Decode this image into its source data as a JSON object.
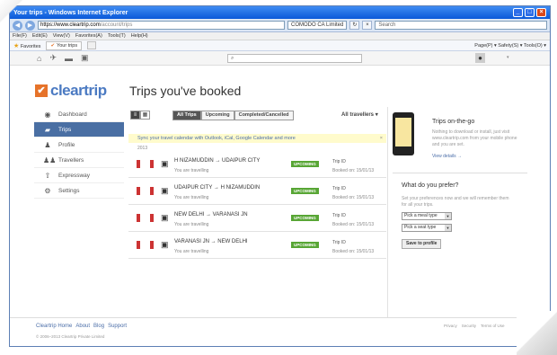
{
  "browser": {
    "title": "Your trips - Windows Internet Explorer",
    "url_host": "https://www.cleartrip.com",
    "url_path": "/account/trips",
    "cert_label": "COMODO CA Limited",
    "search_placeholder": "Search",
    "menu": [
      "File(F)",
      "Edit(E)",
      "View(V)",
      "Favorites(A)",
      "Tools(T)",
      "Help(H)"
    ],
    "favorites_label": "Favorites",
    "tab_label": "Your trips",
    "tools_label": "Page(P) ▾  Safety(S) ▾  Tools(O) ▾"
  },
  "site": {
    "search_icon": "⌕",
    "brand": "cleartrip",
    "page_title": "Trips you've booked"
  },
  "sidebar": {
    "items": [
      {
        "label": "Dashboard",
        "icon": "eye-icon"
      },
      {
        "label": "Trips",
        "icon": "suitcase-icon"
      },
      {
        "label": "Profile",
        "icon": "person-icon"
      },
      {
        "label": "Travellers",
        "icon": "people-icon"
      },
      {
        "label": "Expressway",
        "icon": "arrow-up-icon"
      },
      {
        "label": "Settings",
        "icon": "gear-icon"
      }
    ]
  },
  "main": {
    "tabs": [
      "All Trips",
      "Upcoming",
      "Completed/Cancelled"
    ],
    "all_travellers": "All travellers ▾",
    "notice": "Sync your travel calendar with Outlook, iCal, Google Calendar and more",
    "year": "2013",
    "trips": [
      {
        "route": "H NIZAMUDDIN → UDAIPUR CITY",
        "traveller": "You are travelling",
        "badge": "UPCOMING",
        "trip_id": "Trip ID",
        "booked": "Booked on: 15/01/13"
      },
      {
        "route": "UDAIPUR CITY → H NIZAMUDDIN",
        "traveller": "You are travelling",
        "badge": "UPCOMING",
        "trip_id": "Trip ID",
        "booked": "Booked on: 15/01/13"
      },
      {
        "route": "NEW DELHI → VARANASI JN",
        "traveller": "You are travelling",
        "badge": "UPCOMING",
        "trip_id": "Trip ID",
        "booked": "Booked on: 15/01/13"
      },
      {
        "route": "VARANASI JN → NEW DELHI",
        "traveller": "You are travelling",
        "badge": "UPCOMING",
        "trip_id": "Trip ID",
        "booked": "Booked on: 15/01/13"
      }
    ]
  },
  "right": {
    "onthego_title": "Trips on-the-go",
    "onthego_body": "Nothing to download or install, just visit www.cleartrip.com from your mobile phone and you are set.",
    "onthego_link": "View details →",
    "pref_title": "What do you prefer?",
    "pref_body": "Set your preferences now and we will remember them for all your trips.",
    "meal_select": "Pick a meal type",
    "seat_select": "Pick a seat type",
    "save_button": "Save to profile"
  },
  "footer": {
    "links": [
      "Cleartrip Home",
      "About",
      "Blog",
      "Support"
    ],
    "copyright": "© 2006–2013 Cleartrip Private Limited",
    "right_links": [
      "Privacy",
      "Security",
      "Terms of Use"
    ]
  },
  "colors": {
    "accent": "#4a6fa3",
    "brand_orange": "#e6732a",
    "upcoming_green": "#58a635"
  }
}
